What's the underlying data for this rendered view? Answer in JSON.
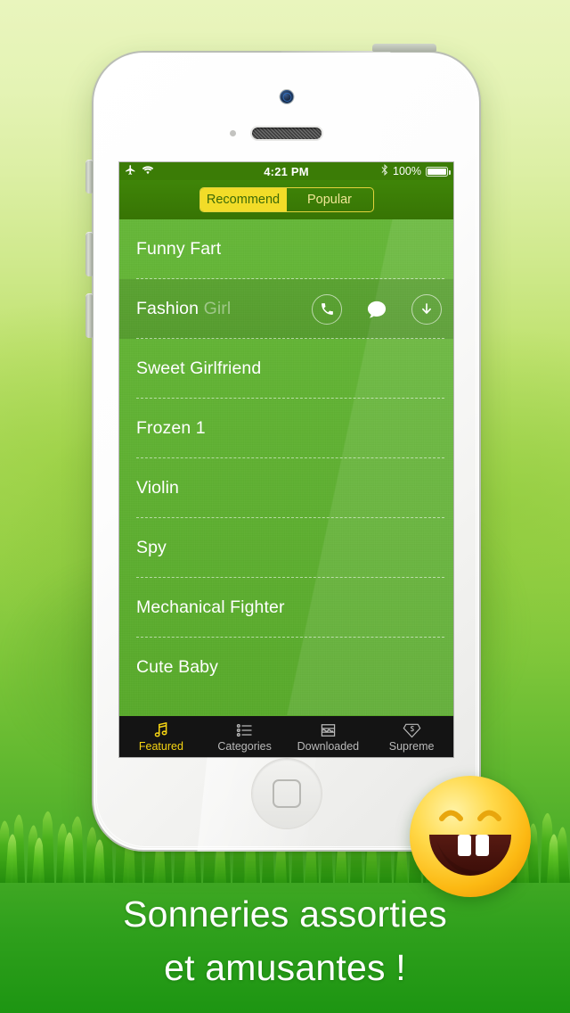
{
  "background": {
    "top_color": "#e9f5bd",
    "bottom_color": "#1d9512"
  },
  "caption": {
    "line1": "Sonneries assorties",
    "line2": "et amusantes !",
    "color": "#ffffff"
  },
  "emoji": {
    "name": "grinning-face-emoji",
    "face_color": "#ffd63b",
    "mouth_color": "#4a1410"
  },
  "device": {
    "model": "white-iphone",
    "buttons": {
      "power": "power-button",
      "mute": "mute-switch",
      "volume_up": "volume-up-button",
      "volume_down": "volume-down-button",
      "home": "home-button"
    }
  },
  "screen": {
    "status_bar": {
      "airplane_icon": "airplane-mode-icon",
      "wifi_icon": "wifi-icon",
      "time": "4:21 PM",
      "bluetooth_icon": "bluetooth-icon",
      "battery_percent": "100%",
      "battery_level": 100,
      "background_color": "#3b7c06"
    },
    "nav_bar": {
      "segments": [
        {
          "label": "Recommend",
          "selected": true
        },
        {
          "label": "Popular",
          "selected": false
        }
      ],
      "selected_bg": "#f2dc28",
      "selected_text": "#3c6a06",
      "unselected_text": "#f0e694"
    },
    "list": {
      "background_color": "#5db32d",
      "rows": [
        {
          "title": "Funny Fart",
          "dim_suffix": "",
          "expanded": false
        },
        {
          "title": "Fashion ",
          "dim_suffix": "Girl",
          "expanded": true
        },
        {
          "title": "Sweet Girlfriend",
          "dim_suffix": "",
          "expanded": false
        },
        {
          "title": "Frozen 1",
          "dim_suffix": "",
          "expanded": false
        },
        {
          "title": "Violin",
          "dim_suffix": "",
          "expanded": false
        },
        {
          "title": "Spy",
          "dim_suffix": "",
          "expanded": false
        },
        {
          "title": "Mechanical Fighter",
          "dim_suffix": "",
          "expanded": false
        },
        {
          "title": "Cute Baby",
          "dim_suffix": "",
          "expanded": false
        }
      ],
      "row_actions": [
        {
          "name": "set-as-ringtone-button",
          "icon": "phone-icon"
        },
        {
          "name": "set-as-text-tone-button",
          "icon": "message-bubble-icon"
        },
        {
          "name": "download-button",
          "icon": "download-arrow-icon"
        }
      ]
    },
    "tab_bar": {
      "background_color": "#141414",
      "active_color": "#f7d513",
      "inactive_color": "#b9b9b9",
      "tabs": [
        {
          "label": "Featured",
          "icon": "music-note-icon",
          "active": true
        },
        {
          "label": "Categories",
          "icon": "list-bullets-icon",
          "active": false
        },
        {
          "label": "Downloaded",
          "icon": "waveform-box-icon",
          "active": false
        },
        {
          "label": "Supreme",
          "icon": "diamond-s-icon",
          "active": false
        }
      ]
    }
  }
}
